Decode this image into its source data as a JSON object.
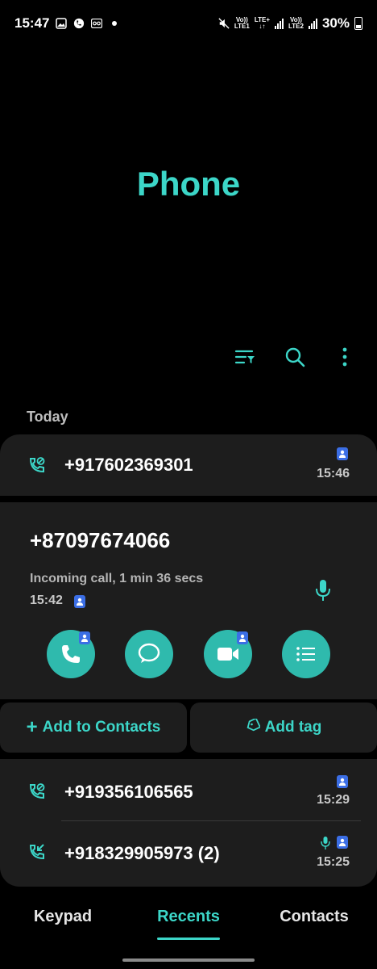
{
  "status_bar": {
    "time": "15:47",
    "sim1_top": "Vo))",
    "sim1_bottom": "LTE1",
    "sim1_net": "LTE+",
    "sim2_top": "Vo))",
    "sim2_bottom": "LTE2",
    "battery": "30%"
  },
  "app_title": "Phone",
  "toolbar_icons": [
    "filter-icon",
    "search-icon",
    "more-options-icon"
  ],
  "section_label": "Today",
  "calls": [
    {
      "number": "+917602369301",
      "time": "15:46",
      "type": "call-rejected-icon"
    },
    {
      "number": "+919356106565",
      "time": "15:29",
      "type": "call-rejected-icon"
    },
    {
      "number": "+918329905973 (2)",
      "time": "15:25",
      "type": "incoming-call-icon"
    }
  ],
  "expanded": {
    "number": "+87097674066",
    "description": "Incoming call, 1 min 36 secs",
    "time": "15:42",
    "actions": [
      "call-icon",
      "message-icon",
      "video-call-icon",
      "details-icon"
    ]
  },
  "buttons": {
    "add_contacts": "Add to Contacts",
    "add_tag": "Add tag"
  },
  "tabs": [
    {
      "label": "Keypad",
      "active": false
    },
    {
      "label": "Recents",
      "active": true
    },
    {
      "label": "Contacts",
      "active": false
    }
  ],
  "colors": {
    "accent": "#3cd6c8",
    "action_bg": "#2fbaad",
    "badge": "#3b6ee5",
    "card": "#1d1d1d"
  }
}
